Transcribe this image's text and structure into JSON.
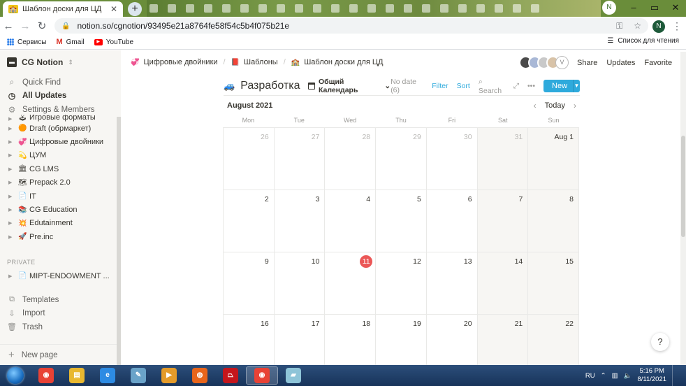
{
  "browser": {
    "tab_title": "Шаблон доски для ЦД",
    "new_tab_symbol": "+",
    "profile_initial": "N",
    "window_min": "–",
    "window_max": "▭",
    "window_close": "✕",
    "url": "notion.so/cgnotion/93495e21a8764fe58f54c5b4f075b21e",
    "account_initial": "N"
  },
  "bookmarks": {
    "items": [
      {
        "label": "Сервисы",
        "icon": "apps-grid-icon"
      },
      {
        "label": "Gmail",
        "icon": "gmail-icon"
      },
      {
        "label": "YouTube",
        "icon": "youtube-icon"
      }
    ],
    "reading_list": "Список для чтения"
  },
  "sidebar": {
    "workspace": "CG Notion",
    "top": [
      {
        "label": "Quick Find",
        "icon": "search-icon"
      },
      {
        "label": "All Updates",
        "icon": "clock-icon"
      },
      {
        "label": "Settings & Members",
        "icon": "gear-icon"
      }
    ],
    "pages": [
      {
        "label": "Игровые форматы",
        "emoji": "🕹"
      },
      {
        "label": "Draft (обрмаркет)",
        "emoji": "🟠"
      },
      {
        "label": "Цифровые двойники",
        "emoji": "💞"
      },
      {
        "label": "ЦУМ",
        "emoji": "💫"
      },
      {
        "label": "CG LMS",
        "emoji": "🏛"
      },
      {
        "label": "Prepack 2.0",
        "emoji": "🗺"
      },
      {
        "label": "IT",
        "emoji": "📄"
      },
      {
        "label": "CG Education",
        "emoji": "📚"
      },
      {
        "label": "Edutainment",
        "emoji": "💥"
      },
      {
        "label": "Pre.inc",
        "emoji": "🚀"
      }
    ],
    "private_header": "PRIVATE",
    "private_pages": [
      {
        "label": "MIPT-ENDOWMENT ...",
        "emoji": "📄"
      }
    ],
    "bottom": [
      {
        "label": "Templates",
        "icon": "templates-icon"
      },
      {
        "label": "Import",
        "icon": "import-icon"
      },
      {
        "label": "Trash",
        "icon": "trash-icon"
      }
    ],
    "new_page": "New page"
  },
  "topbar": {
    "breadcrumbs": [
      {
        "label": "Цифровые двойники",
        "emoji": "💞"
      },
      {
        "label": "Шаблоны",
        "emoji": "📕"
      },
      {
        "label": "Шаблон доски для ЦД",
        "emoji": "🏫"
      }
    ],
    "avatar_letter": "V",
    "share": "Share",
    "updates": "Updates",
    "favorite": "Favorite",
    "more": "•••"
  },
  "database": {
    "title": "Разработка",
    "view_name": "Общий Календарь",
    "no_date": "No date (6)",
    "filter": "Filter",
    "sort": "Sort",
    "search": "Search",
    "new_label": "New",
    "more": "•••"
  },
  "calendar": {
    "month": "August 2021",
    "today": "Today",
    "weekdays": [
      "Mon",
      "Tue",
      "Wed",
      "Thu",
      "Fri",
      "Sat",
      "Sun"
    ],
    "today_date": "11",
    "weeks": [
      [
        "26",
        "27",
        "28",
        "29",
        "30",
        "31",
        "Aug 1"
      ],
      [
        "2",
        "3",
        "4",
        "5",
        "6",
        "7",
        "8"
      ],
      [
        "9",
        "10",
        "11",
        "12",
        "13",
        "14",
        "15"
      ],
      [
        "16",
        "17",
        "18",
        "19",
        "20",
        "21",
        "22"
      ]
    ]
  },
  "help": "?",
  "taskbar": {
    "apps": [
      {
        "name": "chrome",
        "color": "#e84235"
      },
      {
        "name": "explorer",
        "color": "#e8b830"
      },
      {
        "name": "internet-explorer",
        "color": "#2d8be3"
      },
      {
        "name": "tool",
        "color": "#6aa3c9"
      },
      {
        "name": "media-player",
        "color": "#e49b2a"
      },
      {
        "name": "firefox",
        "color": "#e8651b"
      },
      {
        "name": "acrobat",
        "color": "#c4161c"
      },
      {
        "name": "chrome-active",
        "color": "#e84235"
      },
      {
        "name": "notes",
        "color": "#8ec4d8"
      }
    ],
    "language": "RU",
    "time": "5:16 PM",
    "date": "8/11/2021"
  }
}
